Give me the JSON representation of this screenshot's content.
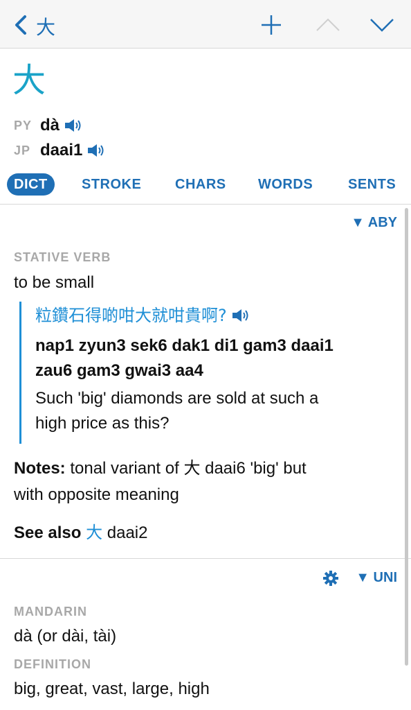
{
  "topbar": {
    "title": "大",
    "icons": [
      "back-chevron-icon",
      "plus-icon",
      "chevron-up-icon",
      "chevron-down-icon"
    ]
  },
  "entry": {
    "character": "大",
    "readings": [
      {
        "tag": "PY",
        "value": "dà"
      },
      {
        "tag": "JP",
        "value": "daai1"
      }
    ]
  },
  "tabs": [
    "DICT",
    "STROKE",
    "CHARS",
    "WORDS",
    "SENTS"
  ],
  "active_tab": "DICT",
  "dict_section": {
    "source": "▼ ABY",
    "pos": "STATIVE VERB",
    "definition": "to be small",
    "example": {
      "chinese": "粒鑽石得啲咁大就咁貴啊?",
      "jyutping_line1": "nap1 zyun3 sek6 dak1 di1 gam3 daai1",
      "jyutping_line2": "zau6 gam3 gwai3 aa4",
      "english_line1": "Such 'big' diamonds are sold at such a",
      "english_line2": "high price as this?"
    },
    "notes_label": "Notes:",
    "notes_pre": " tonal variant of ",
    "notes_char": "大",
    "notes_post": " daai6 'big' but",
    "notes_line2": "with opposite meaning",
    "see_also_label": "See also",
    "see_also_char": "大",
    "see_also_reading": "daai2"
  },
  "uni_section": {
    "source": "▼ UNI",
    "mandarin_label": "MANDARIN",
    "mandarin_value": "dà (or dài, tài)",
    "definition_label": "DEFINITION",
    "definition_value": "big, great, vast, large, high"
  },
  "colors": {
    "accent": "#1f6fb5",
    "link": "#1f8fd6",
    "headchar": "#1aa3c8",
    "muted": "#a8a8a8"
  }
}
